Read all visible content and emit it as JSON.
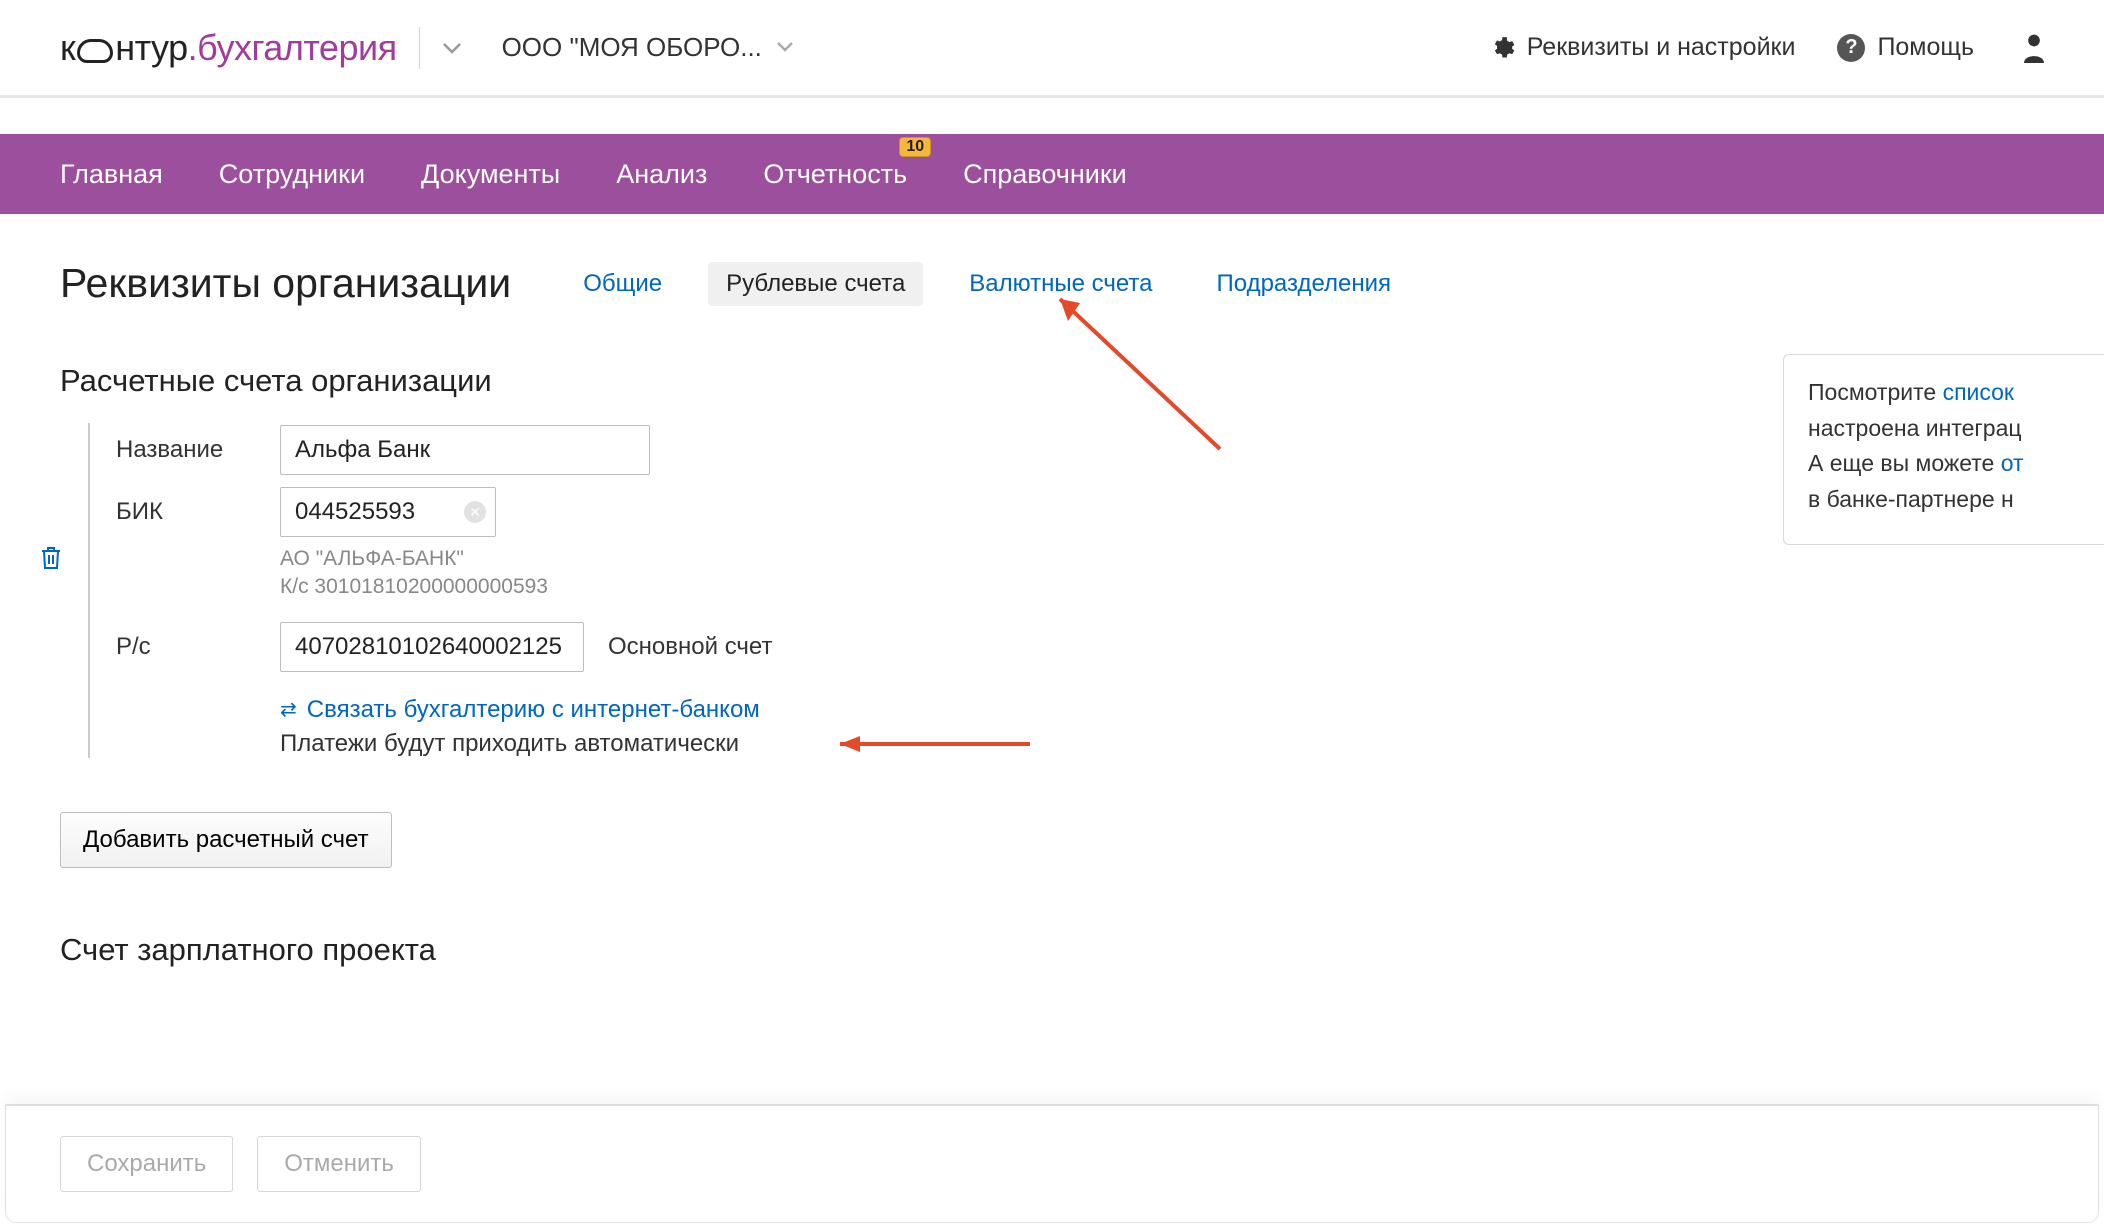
{
  "header": {
    "logo_prefix": "к",
    "logo_mid": "нтур",
    "logo_suffix": ".бухгалтерия",
    "company_label": "ООО \"МОЯ ОБОРО...",
    "settings_label": "Реквизиты и настройки",
    "help_label": "Помощь"
  },
  "nav": {
    "items": [
      {
        "label": "Главная"
      },
      {
        "label": "Сотрудники"
      },
      {
        "label": "Документы"
      },
      {
        "label": "Анализ"
      },
      {
        "label": "Отчетность",
        "badge": "10"
      },
      {
        "label": "Справочники"
      }
    ]
  },
  "page": {
    "title": "Реквизиты организации",
    "tabs": [
      {
        "label": "Общие",
        "active": false
      },
      {
        "label": "Рублевые счета",
        "active": true
      },
      {
        "label": "Валютные счета",
        "active": false
      },
      {
        "label": "Подразделения",
        "active": false
      }
    ],
    "section_accounts": "Расчетные счета организации",
    "labels": {
      "name": "Название",
      "bik": "БИК",
      "rs": "Р/с"
    },
    "values": {
      "name": "Альфа Банк",
      "bik": "044525593",
      "rs": "40702810102640002125"
    },
    "bik_help_line1": "АО \"АЛЬФА-БАНК\"",
    "bik_help_line2": "К/с 30101810200000000593",
    "rs_note": "Основной счет",
    "link_ibank": "Связать бухгалтерию с интернет-банком",
    "link_sub": "Платежи будут приходить автоматически",
    "add_account": "Добавить расчетный счет",
    "salary_title": "Счет зарплатного проекта"
  },
  "info_panel": {
    "line1a": "Посмотрите ",
    "line1b": "список",
    "line2": "настроена интеграц",
    "line3a": "А еще вы можете ",
    "line3b": "от",
    "line4": "в банке-партнере н"
  },
  "footer": {
    "save": "Сохранить",
    "cancel": "Отменить"
  }
}
